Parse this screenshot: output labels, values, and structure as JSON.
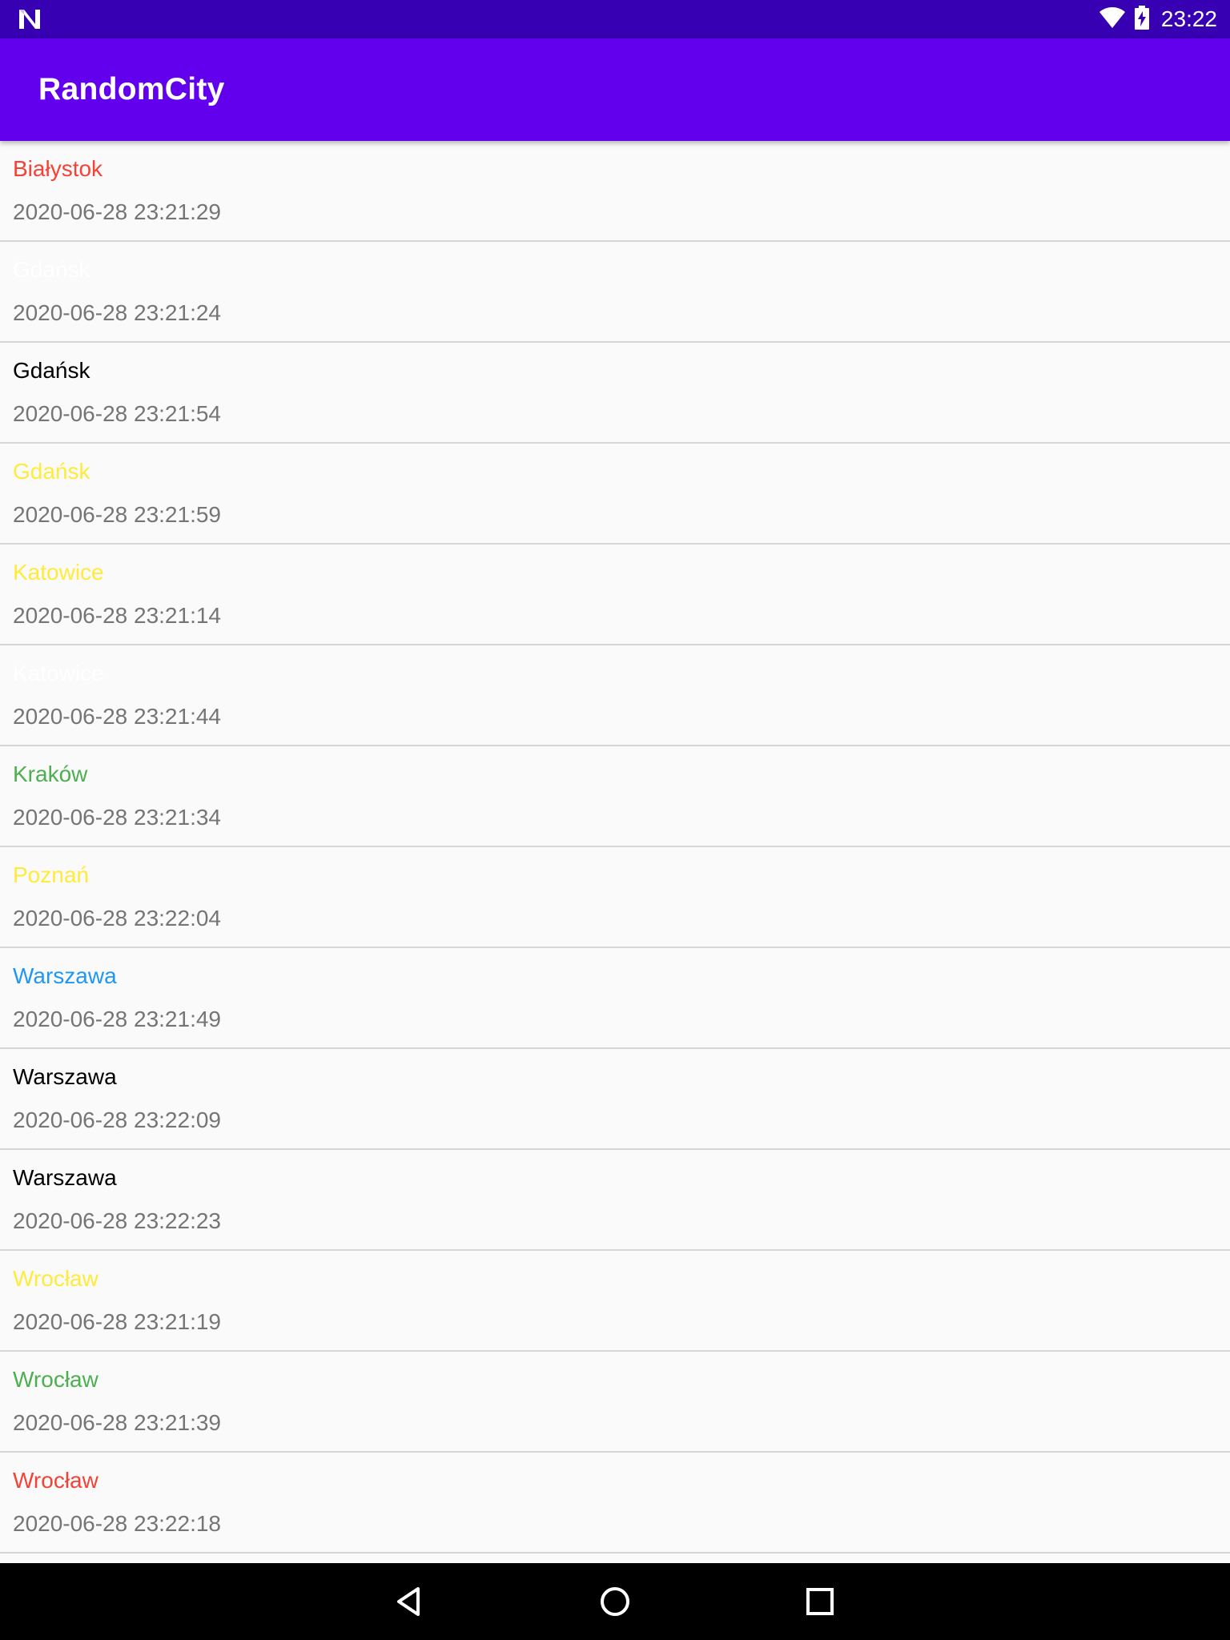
{
  "status_bar": {
    "time": "23:22",
    "icons": [
      "notification-n-icon",
      "wifi-icon",
      "battery-charging-icon"
    ]
  },
  "app_bar": {
    "title": "RandomCity"
  },
  "colors": {
    "status_bar": "#3700b3",
    "app_bar": "#6200ee",
    "red": "#f44336",
    "white": "#ffffff",
    "black": "#000000",
    "yellow": "#ffeb3b",
    "green": "#4caf50",
    "blue": "#2196f3",
    "timestamp": "#757575"
  },
  "list": {
    "items": [
      {
        "city": "Białystok",
        "time": "2020-06-28 23:21:29",
        "color": "#f44336"
      },
      {
        "city": "Gdańsk",
        "time": "2020-06-28 23:21:24",
        "color": "#ffffff"
      },
      {
        "city": "Gdańsk",
        "time": "2020-06-28 23:21:54",
        "color": "#000000"
      },
      {
        "city": "Gdańsk",
        "time": "2020-06-28 23:21:59",
        "color": "#ffeb3b"
      },
      {
        "city": "Katowice",
        "time": "2020-06-28 23:21:14",
        "color": "#ffeb3b"
      },
      {
        "city": "Katowice",
        "time": "2020-06-28 23:21:44",
        "color": "#ffffff"
      },
      {
        "city": "Kraków",
        "time": "2020-06-28 23:21:34",
        "color": "#4caf50"
      },
      {
        "city": "Poznań",
        "time": "2020-06-28 23:22:04",
        "color": "#ffeb3b"
      },
      {
        "city": "Warszawa",
        "time": "2020-06-28 23:21:49",
        "color": "#2196f3"
      },
      {
        "city": "Warszawa",
        "time": "2020-06-28 23:22:09",
        "color": "#000000"
      },
      {
        "city": "Warszawa",
        "time": "2020-06-28 23:22:23",
        "color": "#000000"
      },
      {
        "city": "Wrocław",
        "time": "2020-06-28 23:21:19",
        "color": "#ffeb3b"
      },
      {
        "city": "Wrocław",
        "time": "2020-06-28 23:21:39",
        "color": "#4caf50"
      },
      {
        "city": "Wrocław",
        "time": "2020-06-28 23:22:18",
        "color": "#f44336"
      }
    ]
  },
  "nav_bar": {
    "buttons": [
      "back-icon",
      "home-icon",
      "recents-icon"
    ]
  }
}
